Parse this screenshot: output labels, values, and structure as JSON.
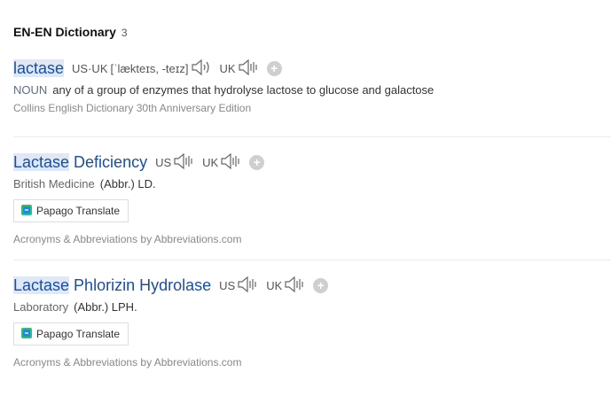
{
  "section": {
    "title": "EN-EN Dictionary",
    "count": "3"
  },
  "entries": [
    {
      "word_hl": "lactase",
      "word_rest": "",
      "pron": {
        "us_uk_label": "US·UK",
        "ipa": "[ˈlækteɪs, -teɪz]",
        "uk_label": "UK"
      },
      "def_prefix": "NOUN",
      "definition": "any of a group of enzymes that hydrolyse lactose to glucose and galactose",
      "source": "Collins English Dictionary 30th Anniversary Edition"
    },
    {
      "word_hl": "Lactase",
      "word_rest": " Deficiency",
      "pron": {
        "us_label": "US",
        "uk_label": "UK"
      },
      "def_prefix": "British Medicine",
      "definition": "(Abbr.) LD.",
      "translate_button": "Papago Translate",
      "source": "Acronyms & Abbreviations by Abbreviations.com"
    },
    {
      "word_hl": "Lactase",
      "word_rest": " Phlorizin Hydrolase",
      "pron": {
        "us_label": "US",
        "uk_label": "UK"
      },
      "def_prefix": "Laboratory",
      "definition": "(Abbr.) LPH.",
      "translate_button": "Papago Translate",
      "source": "Acronyms & Abbreviations by Abbreviations.com"
    }
  ],
  "icons": {
    "speaker": "speaker-icon",
    "add": "plus-circle-icon",
    "translate_logo": "papago-logo-icon"
  },
  "colors": {
    "link": "#1a4ea3",
    "highlight": "#dfe8f7",
    "muted": "#888888"
  }
}
